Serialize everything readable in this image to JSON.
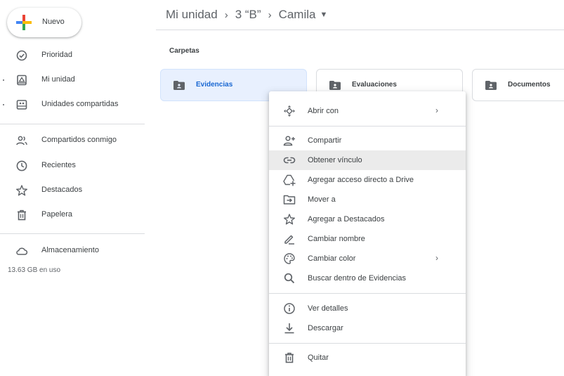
{
  "sidebar": {
    "new_label": "Nuevo",
    "items": [
      {
        "label": "Prioridad",
        "icon": "check-circle-icon"
      },
      {
        "label": "Mi unidad",
        "icon": "drive-icon"
      },
      {
        "label": "Unidades compartidas",
        "icon": "shared-drives-icon"
      },
      {
        "label": "Compartidos conmigo",
        "icon": "people-icon"
      },
      {
        "label": "Recientes",
        "icon": "clock-icon"
      },
      {
        "label": "Destacados",
        "icon": "star-icon"
      },
      {
        "label": "Papelera",
        "icon": "trash-icon"
      },
      {
        "label": "Almacenamiento",
        "icon": "cloud-icon"
      }
    ],
    "storage_text": "13.63 GB en uso"
  },
  "header": {
    "breadcrumb": [
      "Mi unidad",
      "3 “B”",
      "Camila"
    ],
    "separator": "›"
  },
  "main": {
    "section_title": "Carpetas",
    "folders": [
      {
        "name": "Evidencias",
        "selected": true
      },
      {
        "name": "Evaluaciones",
        "selected": false
      },
      {
        "name": "Documentos",
        "selected": false
      }
    ]
  },
  "context_menu": {
    "items": [
      {
        "label": "Abrir con",
        "icon": "move-arrows-icon",
        "submenu": true
      },
      {
        "label": "Compartir",
        "icon": "person-add-icon"
      },
      {
        "label": "Obtener vínculo",
        "icon": "link-icon",
        "highlighted": true
      },
      {
        "label": "Agregar acceso directo a Drive",
        "icon": "add-shortcut-icon"
      },
      {
        "label": "Mover a",
        "icon": "move-to-folder-icon"
      },
      {
        "label": "Agregar a Destacados",
        "icon": "star-outline-icon"
      },
      {
        "label": "Cambiar nombre",
        "icon": "pencil-icon"
      },
      {
        "label": "Cambiar color",
        "icon": "palette-icon",
        "submenu": true
      },
      {
        "label": "Buscar dentro de Evidencias",
        "icon": "search-icon"
      },
      {
        "label": "Ver detalles",
        "icon": "info-icon"
      },
      {
        "label": "Descargar",
        "icon": "download-icon"
      },
      {
        "label": "Quitar",
        "icon": "trash-icon"
      }
    ],
    "submenu_arrow": "›"
  },
  "colors": {
    "selected_folder_bg": "#e8f0fe",
    "selected_folder_text": "#1967d2",
    "menu_hover": "#ebebeb",
    "divider": "#dadce0"
  }
}
